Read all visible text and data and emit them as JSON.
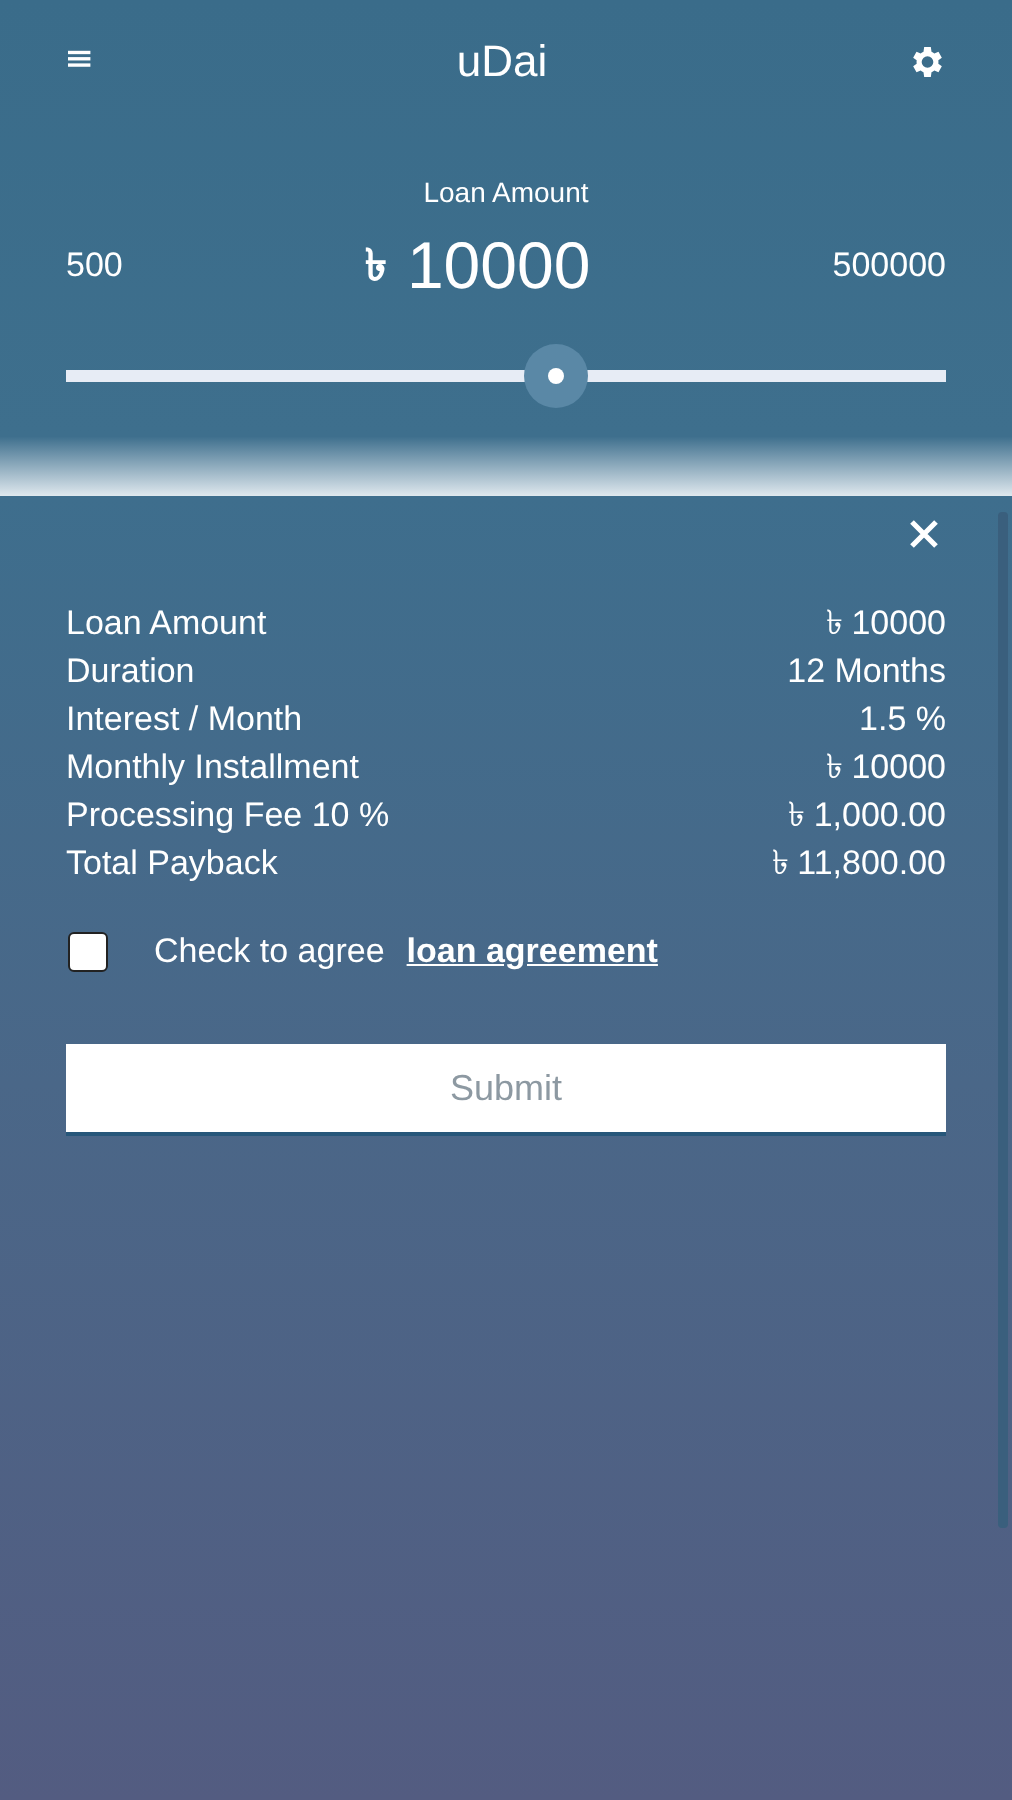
{
  "app_bar": {
    "title": "uDai"
  },
  "loan_slider": {
    "label": "Loan Amount",
    "min": "500",
    "max": "500000",
    "currency": "৳",
    "value": "10000",
    "level": 0.556
  },
  "summary": {
    "rows": [
      {
        "label": "Loan Amount",
        "value": "৳ 10000"
      },
      {
        "label": "Duration",
        "value": "12 Months"
      },
      {
        "label": "Interest / Month",
        "value": "1.5 %"
      },
      {
        "label": "Monthly Installment",
        "value": "৳ 10000"
      },
      {
        "label": "Processing Fee 10 %",
        "value": "৳ 1,000.00"
      },
      {
        "label": "Total Payback",
        "value": "৳ 11,800.00"
      }
    ]
  },
  "agreement": {
    "checked": false,
    "text": "Check to agree",
    "link": "loan agreement"
  },
  "submit": {
    "label": "Submit"
  }
}
